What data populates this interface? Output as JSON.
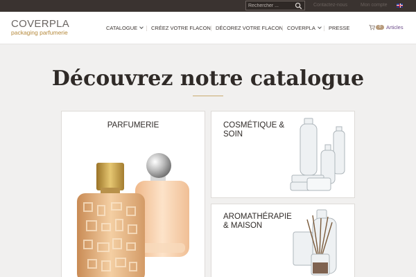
{
  "topbar": {
    "search_placeholder": "Rechercher ...",
    "links": [
      "Contactez-nous",
      "Mon compte"
    ]
  },
  "header": {
    "logo_name": "COVERPLA",
    "logo_tagline": "packaging parfumerie",
    "nav": [
      {
        "label": "CATALOGUE",
        "dropdown": true
      },
      {
        "label": "CRÉEZ VOTRE FLACON",
        "dropdown": false
      },
      {
        "label": "DÉCOREZ VOTRE FLACON",
        "dropdown": false
      },
      {
        "label": "COVERPLA",
        "dropdown": true
      },
      {
        "label": "PRESSE",
        "dropdown": false
      }
    ],
    "cart_count": "0",
    "cart_label": "Articles"
  },
  "page": {
    "title": "Découvrez notre catalogue"
  },
  "categories": [
    {
      "label": "PARFUMERIE"
    },
    {
      "label_line1": "COSMÉTIQUE &",
      "label_line2": "SOIN"
    },
    {
      "label_line1": "AROMATHÉRAPIE",
      "label_line2": "& MAISON"
    }
  ],
  "colors": {
    "topbar": "#3a3330",
    "accent_gold": "#c8ab6e",
    "cart_link": "#6d4d8a",
    "page_bg": "#f1f0ef"
  }
}
